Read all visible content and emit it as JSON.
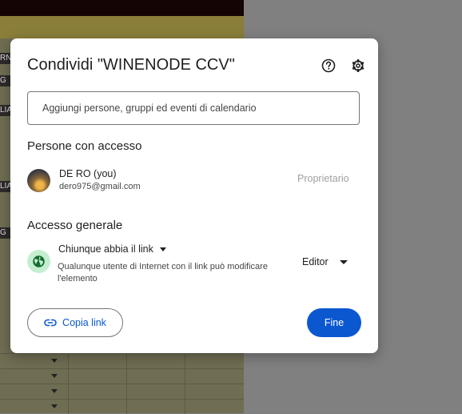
{
  "background_sheet": {
    "row_labels": [
      "RN",
      "G",
      "LIA",
      "LIA",
      "G"
    ]
  },
  "dialog": {
    "title": "Condividi \"WINENODE CCV\"",
    "help_icon": "help-circle-icon",
    "settings_icon": "gear-icon",
    "add_people_placeholder": "Aggiungi persone, gruppi ed eventi di calendario",
    "people_section_title": "Persone con accesso",
    "owner": {
      "name": "DE RO (you)",
      "email": "dero975@gmail.com",
      "role": "Proprietario"
    },
    "general_access": {
      "section_title": "Accesso generale",
      "scope": "Chiunque abbia il link",
      "description": "Qualunque utente di Internet con il link può modificare l'elemento",
      "permission": "Editor"
    },
    "copy_link_label": "Copia link",
    "done_label": "Fine"
  },
  "colors": {
    "primary": "#0b57d0",
    "globe_background": "#c4eed0",
    "globe_icon": "#146c2e"
  }
}
